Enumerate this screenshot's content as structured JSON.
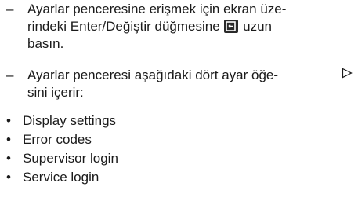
{
  "para1": {
    "dash": "–",
    "line1": "Ayarlar penceresine erişmek için ekran üze-",
    "line2_before": "rindeki Enter/Değiştir düğmesine",
    "line2_after": "uzun",
    "line3": "basın.",
    "icon": "enter-change-icon"
  },
  "para2": {
    "dash": "–",
    "line1": "Ayarlar penceresi aşağıdaki dört ayar öğe-",
    "line2": "sini içerir:",
    "marker_icon": "triangle-right-outline-icon"
  },
  "bullet_char": "•",
  "items": [
    "Display settings",
    "Error codes",
    "Supervisor login",
    "Service login"
  ]
}
